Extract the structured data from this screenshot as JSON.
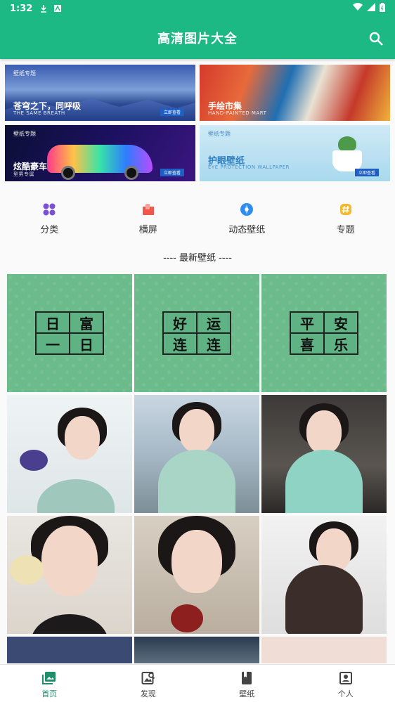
{
  "status_bar": {
    "time": "1:32"
  },
  "app_bar": {
    "title": "高清图片大全"
  },
  "banners": [
    {
      "tag": "壁纸专题",
      "title": "苍穹之下，同呼吸",
      "subtitle": "THE SAME BREATH",
      "button": "立即查看"
    },
    {
      "tag": "",
      "title": "手绘市集",
      "subtitle": "HAND-PAINTED MART",
      "button": ""
    },
    {
      "tag": "壁纸专题",
      "title": "炫酷豪车",
      "subtitle": "型男专属",
      "button": "立即查看"
    },
    {
      "tag": "壁纸专题",
      "title": "护眼壁纸",
      "subtitle": "EYE PROTECTION WALLPAPER",
      "button": "立即查看"
    }
  ],
  "quick_nav": [
    {
      "label": "分类",
      "icon": "category-icon",
      "color": "#7b4fd6"
    },
    {
      "label": "横屏",
      "icon": "landscape-icon",
      "color": "#f0574a"
    },
    {
      "label": "动态壁纸",
      "icon": "live-wallpaper-icon",
      "color": "#2f8df0"
    },
    {
      "label": "专题",
      "icon": "topic-icon",
      "color": "#f5b72b"
    }
  ],
  "section_title": "---- 最新壁纸 ----",
  "wallpapers_text": [
    [
      "日",
      "富",
      "一",
      "日"
    ],
    [
      "好",
      "运",
      "连",
      "连"
    ],
    [
      "平",
      "安",
      "喜",
      "乐"
    ]
  ],
  "bottom_nav": [
    {
      "label": "首页",
      "icon": "home-gallery-icon",
      "active": true
    },
    {
      "label": "发现",
      "icon": "discover-icon",
      "active": false
    },
    {
      "label": "壁纸",
      "icon": "wallpaper-book-icon",
      "active": false
    },
    {
      "label": "个人",
      "icon": "profile-icon",
      "active": false
    }
  ],
  "colors": {
    "primary": "#1db985",
    "active_tab": "#1f8f6a"
  }
}
